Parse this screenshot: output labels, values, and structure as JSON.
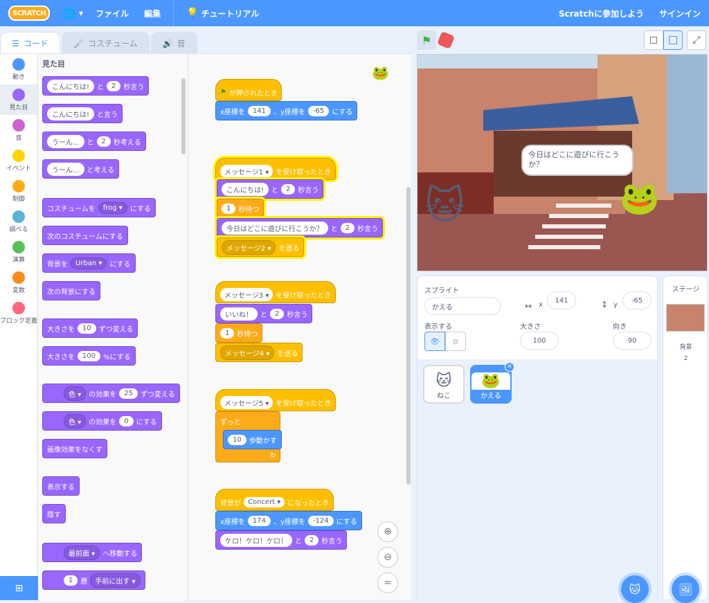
{
  "topbar": {
    "logo": "SCRATCH",
    "file": "ファイル",
    "edit": "編集",
    "tutorial": "チュートリアル",
    "join": "Scratchに参加しよう",
    "signin": "サインイン"
  },
  "tabs": {
    "code": "コード",
    "costume": "コスチューム",
    "sound": "音"
  },
  "categories": [
    {
      "label": "動き",
      "color": "#4c97ff"
    },
    {
      "label": "見た目",
      "color": "#9966ff"
    },
    {
      "label": "音",
      "color": "#cf63cf"
    },
    {
      "label": "イベント",
      "color": "#ffd500"
    },
    {
      "label": "制御",
      "color": "#ffab19"
    },
    {
      "label": "調べる",
      "color": "#5cb1d6"
    },
    {
      "label": "演算",
      "color": "#59c059"
    },
    {
      "label": "変数",
      "color": "#ff8c1a"
    },
    {
      "label": "ブロック定義",
      "color": "#ff6680"
    }
  ],
  "palette": {
    "section": "見た目",
    "b1": {
      "msg": "こんにちは!",
      "to": "と",
      "n": "2",
      "end": "秒言う"
    },
    "b2": {
      "msg": "こんにちは!",
      "end": "と言う"
    },
    "b3": {
      "msg": "うーん...",
      "to": "と",
      "n": "2",
      "end": "秒考える"
    },
    "b4": {
      "msg": "うーん...",
      "end": "と考える"
    },
    "b5": {
      "pre": "コスチュームを",
      "val": "frog",
      "end": "にする"
    },
    "b6": "次のコスチュームにする",
    "b7": {
      "pre": "背景を",
      "val": "Urban",
      "end": "にする"
    },
    "b8": "次の背景にする",
    "b9": {
      "pre": "大きさを",
      "n": "10",
      "end": "ずつ変える"
    },
    "b10": {
      "pre": "大きさを",
      "n": "100",
      "end": "%にする"
    },
    "b11": {
      "val": "色",
      "mid": "の効果を",
      "n": "25",
      "end": "ずつ変える"
    },
    "b12": {
      "val": "色",
      "mid": "の効果を",
      "n": "0",
      "end": "にする"
    },
    "b13": "画像効果をなくす",
    "b14": "表示する",
    "b15": "隠す",
    "b16": {
      "val": "最前面",
      "end": "へ移動する"
    },
    "b17": {
      "n": "1",
      "mid": "層",
      "val": "手前に出す"
    }
  },
  "script1": {
    "hat": "が押されたとき",
    "goto": {
      "pre": "x座標を",
      "x": "141",
      "mid": "、y座標を",
      "y": "-65",
      "end": "にする"
    }
  },
  "script2": {
    "msg": "メッセージ1",
    "hat_end": "を受け取ったとき",
    "say": {
      "msg": "こんにちは!",
      "to": "と",
      "n": "2",
      "end": "秒言う"
    },
    "wait": {
      "n": "1",
      "end": "秒待つ"
    },
    "say2": {
      "msg": "今日はどこに遊びに行こうか？",
      "to": "と",
      "n": "2",
      "end": "秒言う"
    },
    "bcast": {
      "msg": "メッセージ2",
      "end": "を送る"
    }
  },
  "script3": {
    "msg": "メッセージ3",
    "hat_end": "を受け取ったとき",
    "say": {
      "msg": "いいね！",
      "to": "と",
      "n": "2",
      "end": "秒言う"
    },
    "wait": {
      "n": "1",
      "end": "秒待つ"
    },
    "bcast": {
      "msg": "メッセージ4",
      "end": "を送る"
    }
  },
  "script4": {
    "msg": "メッセージ5",
    "hat_end": "を受け取ったとき",
    "forever": "ずっと",
    "move": {
      "n": "10",
      "end": "歩動かす"
    }
  },
  "script5": {
    "pre": "背景が",
    "bg": "Concert",
    "hat_end": "になったとき",
    "goto": {
      "pre": "x座標を",
      "x": "174",
      "mid": "、y座標を",
      "y": "-124",
      "end": "にする"
    },
    "say": {
      "msg": "ケロ！ケロ！ケロ！",
      "to": "と",
      "n": "2",
      "end": "秒言う"
    }
  },
  "stage": {
    "bubble": "今日はどこに遊びに行こうか？"
  },
  "sprite": {
    "label": "スプライト",
    "name": "かえる",
    "x_label": "x",
    "x": "141",
    "y_label": "y",
    "y": "-65",
    "show_label": "表示する",
    "size_label": "大きさ",
    "size": "100",
    "dir_label": "向き",
    "dir": "90",
    "list": [
      {
        "name": "ねこ"
      },
      {
        "name": "かえる"
      }
    ]
  },
  "stagepanel": {
    "title": "ステージ",
    "bg_label": "背景",
    "bg_count": "2"
  },
  "colors": {
    "accent": "#4c97ff",
    "looks": "#9966ff",
    "events": "#ffbf00",
    "control": "#ffab19",
    "motion": "#4c97ff"
  }
}
